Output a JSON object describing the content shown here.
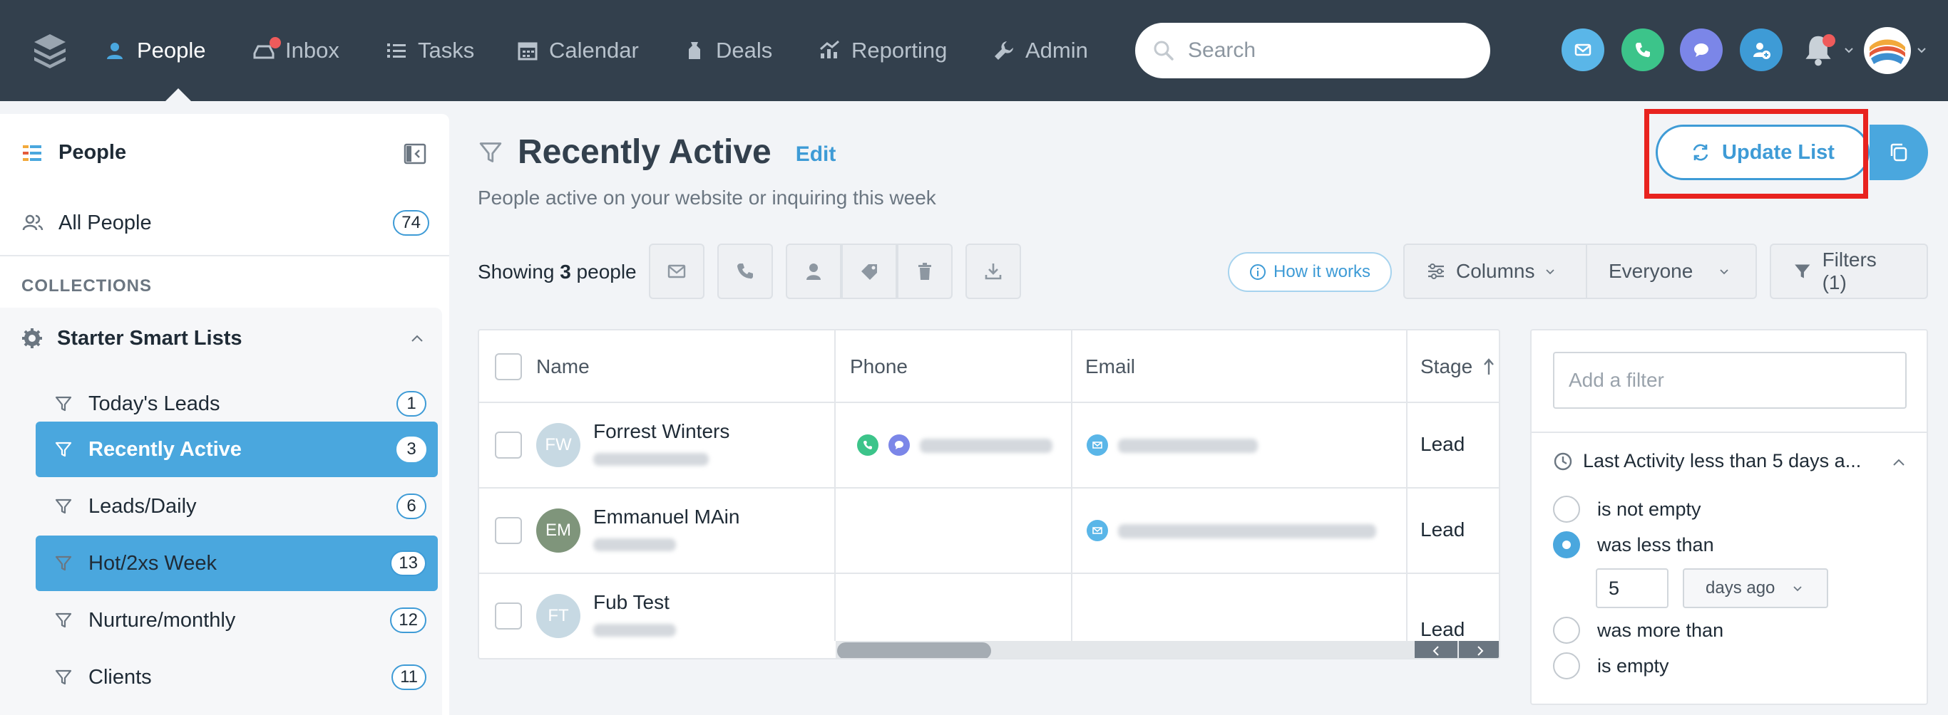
{
  "nav": {
    "items": [
      {
        "label": "People"
      },
      {
        "label": "Inbox"
      },
      {
        "label": "Tasks"
      },
      {
        "label": "Calendar"
      },
      {
        "label": "Deals"
      },
      {
        "label": "Reporting"
      },
      {
        "label": "Admin"
      }
    ],
    "search_placeholder": "Search",
    "colors": {
      "bg": "#33404d",
      "active": "#ffffff",
      "inactive": "#b8c2cc"
    }
  },
  "sidebar": {
    "title": "People",
    "all_people": {
      "label": "All People",
      "count": "74"
    },
    "collections_label": "COLLECTIONS",
    "group": {
      "label": "Starter Smart Lists"
    },
    "items": [
      {
        "label": "Today's Leads",
        "count": "1"
      },
      {
        "label": "Recently Active",
        "count": "3"
      },
      {
        "label": "Leads/Daily",
        "count": "6"
      },
      {
        "label": "Hot/2xs Week",
        "count": "13"
      },
      {
        "label": "Nurture/monthly",
        "count": "12"
      },
      {
        "label": "Clients",
        "count": "11"
      }
    ]
  },
  "main": {
    "title": "Recently Active",
    "edit": "Edit",
    "subtitle": "People active on your website or inquiring this week",
    "update_button": "Update List",
    "showing_prefix": "Showing",
    "showing_count": "3",
    "showing_suffix": "people",
    "how_it_works": "How it works",
    "columns": "Columns",
    "everyone": "Everyone",
    "filters": "Filters (1)"
  },
  "table": {
    "headers": {
      "name": "Name",
      "phone": "Phone",
      "email": "Email",
      "stage": "Stage"
    },
    "rows": [
      {
        "initials": "FW",
        "name": "Forrest Winters",
        "stage": "Lead",
        "avatar_color": "#c7d9e3"
      },
      {
        "initials": "EM",
        "name": "Emmanuel MAin",
        "stage": "Lead",
        "avatar_color": "#7f957b"
      },
      {
        "initials": "FT",
        "name": "Fub Test",
        "stage": "Lead",
        "avatar_color": "#c7d9e3"
      }
    ]
  },
  "filter_panel": {
    "placeholder": "Add a filter",
    "heading": "Last Activity less than 5 days a...",
    "options": [
      {
        "label": "is not empty"
      },
      {
        "label": "was less than"
      },
      {
        "label": "was more than"
      },
      {
        "label": "is empty"
      }
    ],
    "value": "5",
    "unit": "days ago"
  },
  "colors": {
    "accent": "#3e9bd6",
    "highlight": "#e8231f"
  }
}
